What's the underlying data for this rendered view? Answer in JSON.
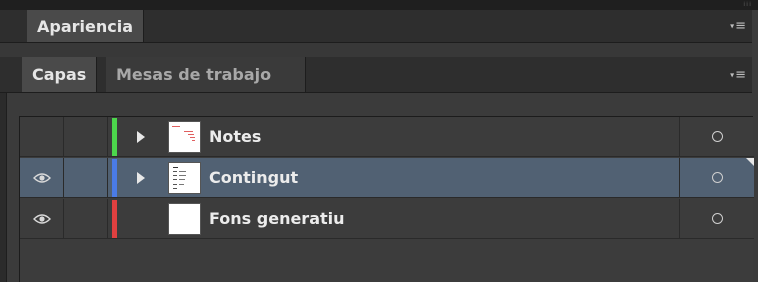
{
  "panels": {
    "appearance": {
      "tab_label": "Apariencia",
      "menu_icon": "panel-menu-icon"
    },
    "layers_group": {
      "tabs": [
        {
          "label": "Capas",
          "active": true
        },
        {
          "label": "Mesas de trabajo",
          "active": false
        }
      ],
      "menu_icon": "panel-menu-icon"
    }
  },
  "layers": [
    {
      "name": "Notes",
      "visible": false,
      "color": "#4cd64c",
      "expandable": true,
      "thumbnail": "notes-thumbnail",
      "selected": false
    },
    {
      "name": "Contingut",
      "visible": true,
      "color": "#4a7be6",
      "expandable": true,
      "thumbnail": "content-thumbnail",
      "selected": true
    },
    {
      "name": "Fons generatiu",
      "visible": true,
      "color": "#e04040",
      "expandable": false,
      "thumbnail": "blank-thumbnail",
      "selected": false
    }
  ],
  "colors": {
    "panel_background": "#3b3b3b",
    "selected_row": "#516173",
    "tab_bar": "#2e2e2e"
  }
}
